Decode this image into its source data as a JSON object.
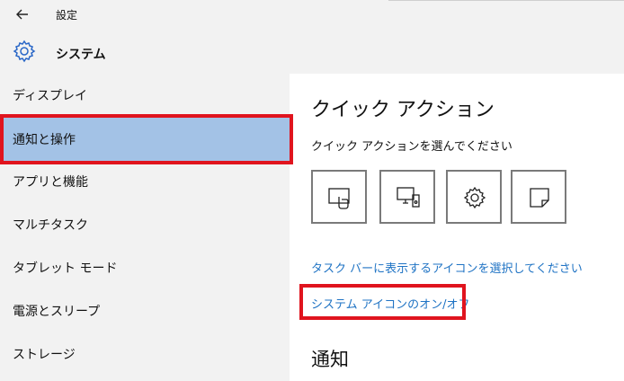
{
  "window": {
    "title": "設定"
  },
  "header": {
    "app_name": "システム"
  },
  "sidebar": {
    "items": [
      {
        "label": "ディスプレイ"
      },
      {
        "label": "通知と操作"
      },
      {
        "label": "アプリと機能"
      },
      {
        "label": "マルチタスク"
      },
      {
        "label": "タブレット モード"
      },
      {
        "label": "電源とスリープ"
      },
      {
        "label": "ストレージ"
      }
    ],
    "selected_index": 1
  },
  "main": {
    "title": "クイック アクション",
    "subtitle": "クイック アクションを選んでください",
    "quick_actions": [
      {
        "icon": "tablet-mode-icon"
      },
      {
        "icon": "connect-icon"
      },
      {
        "icon": "gear-icon"
      },
      {
        "icon": "note-icon"
      }
    ],
    "link_taskbar_icons": "タスク バーに表示するアイコンを選択してください",
    "link_system_icons": "システム アイコンのオン/オフ",
    "section_notifications": "通知"
  },
  "colors": {
    "accent_link": "#1f73c4",
    "selected_bg": "#a3c2e6",
    "highlight_red": "#e0141e"
  }
}
